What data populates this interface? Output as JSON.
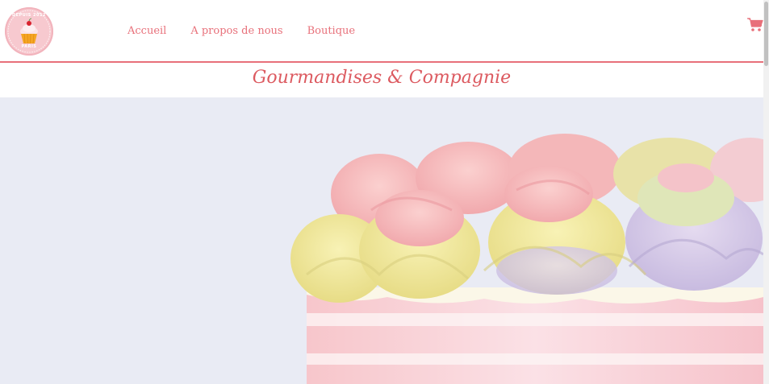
{
  "header": {
    "logo": {
      "top_text": "DEPUIS 2012",
      "bottom_text": "PARIS",
      "icon": "cupcake-icon"
    },
    "nav": [
      {
        "label": "Accueil"
      },
      {
        "label": "A propos de nous"
      },
      {
        "label": "Boutique"
      }
    ],
    "cart_icon": "shopping-cart-icon"
  },
  "brand": {
    "title": "Gourmandises & Compagnie"
  },
  "hero": {
    "image": "rainbow-buttercream-cake"
  },
  "colors": {
    "accent": "#e8707a",
    "title": "#dc5a60",
    "hero_bg": "#e9ebf4"
  }
}
